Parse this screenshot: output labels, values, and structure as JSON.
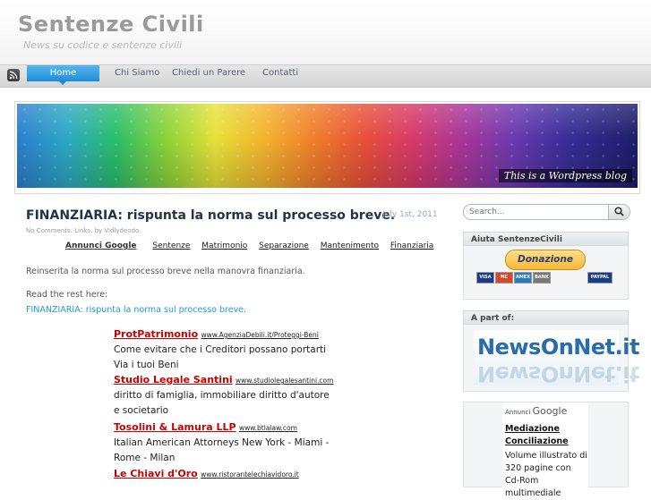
{
  "header": {
    "title": "Sentenze Civili",
    "description": "News su codice e sentenze civili"
  },
  "nav": {
    "items": [
      "Home",
      "Chi Siamo",
      "Chiedi un Parere",
      "Contatti"
    ],
    "active": "Home"
  },
  "banner": {
    "caption": "This is a Wordpress blog"
  },
  "post": {
    "title": "FINANZIARIA: rispunta la norma sul processo breve.",
    "date": "July 1st, 2011",
    "meta": "No Comments. Links. by Vidlydeodo.",
    "ad_links_label": "Annunci Google",
    "ad_links": [
      "Sentenze",
      "Matrimonio",
      "Separazione",
      "Mantenimento",
      "Finanziaria"
    ],
    "paragraph1": "Reinserita la norma sul processo breve nella manovra finanziaria.",
    "paragraph2": "Read the rest here:",
    "link": "FINANZIARIA: rispunta la norma sul processo breve."
  },
  "ads": [
    {
      "title": "ProtPatrimonio",
      "url": "www.AgenziaDebili.it/Proteggi-Beni",
      "text": "Come evitare che i Creditori possano portarti Via i tuoi Beni"
    },
    {
      "title": "Studio Legale Santini",
      "url": "www.studiolegalesantini.com",
      "text": "diritto di famiglia, immobiliare diritto d'autore e societario"
    },
    {
      "title": "Tosolini & Lamura LLP",
      "url": "www.btlalaw.com",
      "text": "Italian American Attorneys New York - Miami - Rome - Milan"
    },
    {
      "title": "Le Chiavi d'Oro",
      "url": "www.ristorantelechiavidoro.it",
      "text": ""
    }
  ],
  "sidebar": {
    "search": {
      "placeholder": "Search..."
    },
    "widget1": {
      "title": "Aiuta SentenzeCivili",
      "button": "Donazione"
    },
    "cards": [
      "VISA",
      "MC",
      "AMEX",
      "BANK",
      "PAYPAL"
    ],
    "widget2": {
      "title": "A part of:",
      "logo": "NewsOnNet.it"
    },
    "google_ads": {
      "label_small": "Annunci",
      "label_brand": "Google",
      "ad_title": "Mediazione Conciliazione",
      "ad_text": "Volume illustrato di 320 pagine con Cd-Rom multimediale"
    }
  },
  "colors": {
    "nav_active": "#1f8dd6",
    "link": "#1e9ad6",
    "ad_title": "#cc0000",
    "title_gray": "#9a9a9a"
  }
}
